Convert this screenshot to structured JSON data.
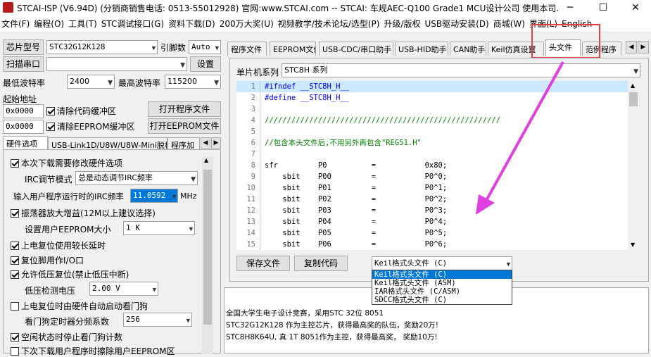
{
  "window": {
    "title": "STCAI-ISP (V6.94D) (分销商销售电话: 0513-55012928) 官网:www.STCAI.com  -- STCAI: 车规AEC-Q100 Grade1 MCU设计公司 使用本司...",
    "min": "─",
    "max": "☐",
    "close": "✕"
  },
  "menu": [
    "文件(F)",
    "编程(O)",
    "工具(T)",
    "STC调试接口(G)",
    "资料下载(D)",
    "200万大奖(U)",
    "视频教学/技术论坛/选型(P)",
    "升级/版权",
    "USB驱动安装(D)",
    "商城(W)",
    "界面(L)",
    "English"
  ],
  "left": {
    "chip_type_btn": "芯片型号",
    "chip_type": "STC32G12K128",
    "pin_label": "引脚数",
    "pin_value": "Auto",
    "scan_port_btn": "扫描串口",
    "port_value": "",
    "settings_btn": "设置",
    "min_baud_label": "最低波特率",
    "min_baud": "2400",
    "max_baud_label": "最高波特率",
    "max_baud": "115200",
    "start_addr_label": "起始地址",
    "addr1": "0x0000",
    "clear_code": "清除代码缓冲区",
    "open_prog": "打开程序文件",
    "addr2": "0x0000",
    "clear_eeprom": "清除EEPROM缓冲区",
    "open_eeprom": "打开EEPROM文件",
    "tabs": [
      "硬件选项",
      "USB-Link1D/U8W/U8W-Mini脱机",
      "程序加"
    ],
    "opts": {
      "modify_hw": "本次下载需要修改硬件选项",
      "irc_mode_label": "IRC调节模式",
      "irc_mode": "总是动态调节IRC频率",
      "irc_freq_label": "输入用户程序运行时的IRC频率",
      "irc_freq": "11.0592",
      "mhz": "MHz",
      "osc_gain": "振荡器放大增益(12M以上建议选择)",
      "eeprom_size_label": "设置用户EEPROM大小",
      "eeprom_size": "1   K",
      "por_long": "上电复位使用较长延时",
      "reset_io": "复位脚用作I/O口",
      "lvr": "允许低压复位(禁止低压中断)",
      "lvd_label": "低压检测电压",
      "lvd": "2.00 V",
      "wdt_auto": "上电复位时由硬件自动启动看门狗",
      "wdt_div_label": "看门狗定时器分频系数",
      "wdt_div": "256",
      "idle_wdt": "空闲状态时停止看门狗计数",
      "erase_eeprom": "下次下载用户程序时擦除用户EEPROM区"
    }
  },
  "right": {
    "tabs": [
      "程序文件",
      "EEPROM文件",
      "USB-CDC/串口助手",
      "USB-HID助手",
      "CAN助手",
      "Keil仿真设置",
      "头文件",
      "范例程序"
    ],
    "series_label": "单片机系列",
    "series": "STC8H 系列",
    "code": [
      {
        "n": "1",
        "t": "#ifndef __STC8H_H__",
        "c": "pp"
      },
      {
        "n": "2",
        "t": "#define __STC8H_H__",
        "c": "pp"
      },
      {
        "n": "3",
        "t": "",
        "c": ""
      },
      {
        "n": "4",
        "t": "/////////////////////////////////////////////////////",
        "c": "cm"
      },
      {
        "n": "5",
        "t": "",
        "c": ""
      },
      {
        "n": "6",
        "t": "//包含本头文件后,不用另外再包含\"REG51.H\"",
        "c": "cm"
      },
      {
        "n": "7",
        "t": "",
        "c": ""
      },
      {
        "n": "8",
        "t": "sfr         P0          =           0x80;",
        "c": ""
      },
      {
        "n": "9",
        "t": "    sbit    P00         =           P0^0;",
        "c": ""
      },
      {
        "n": "10",
        "t": "    sbit    P01         =           P0^1;",
        "c": ""
      },
      {
        "n": "11",
        "t": "    sbit    P02         =           P0^2;",
        "c": ""
      },
      {
        "n": "12",
        "t": "    sbit    P03         =           P0^3;",
        "c": ""
      },
      {
        "n": "13",
        "t": "    sbit    P04         =           P0^4;",
        "c": ""
      },
      {
        "n": "14",
        "t": "    sbit    P05         =           P0^5;",
        "c": ""
      },
      {
        "n": "15",
        "t": "    sbit    P06         =           P0^6;",
        "c": ""
      }
    ],
    "save_btn": "保存文件",
    "copy_btn": "复制代码",
    "format_selected": "Keil格式头文件 (C)",
    "format_options": [
      "Keil格式头文件 (C)",
      "Keil格式头文件 (ASM)",
      "IAR格式头文件 (C/ASM)",
      "SDCC格式头文件 (C)"
    ],
    "log": [
      "全国大学生电子设计竞赛，采用STC 32位 8051",
      "STC32G12K128 作为主控芯片，获得最高奖的队伍，奖励20万!",
      "STC8H8K64U, 真 1T 8051作为主控，获得最高奖， 奖励10万!"
    ]
  },
  "colors": {
    "annotation": "#e83e3e",
    "arrow": "#e040e0",
    "highlight": "#0078d7"
  }
}
